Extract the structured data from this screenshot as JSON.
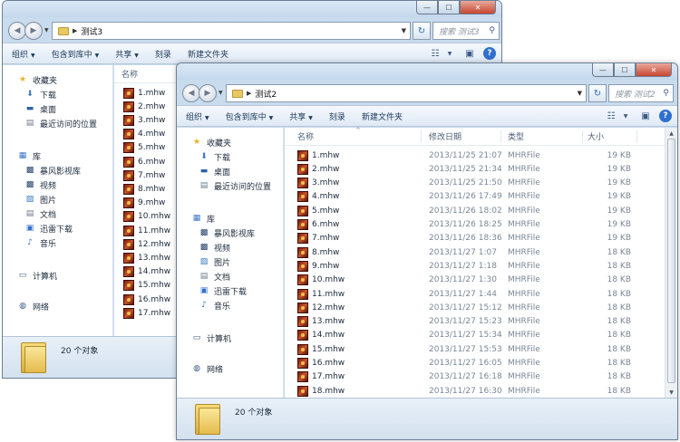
{
  "back_window": {
    "address": "测试3",
    "search_placeholder": "搜索 测试3",
    "commands": [
      "组织",
      "包含到库中",
      "共享",
      "刻录",
      "新建文件夹"
    ],
    "nav": {
      "favorites": {
        "label": "收藏夹",
        "items": [
          "下载",
          "桌面",
          "最近访问的位置"
        ]
      },
      "libraries": {
        "label": "库",
        "items": [
          "暴风影视库",
          "视频",
          "图片",
          "文档",
          "迅雷下载",
          "音乐"
        ]
      },
      "computer": "计算机",
      "network": "网络"
    },
    "column_name": "名称",
    "files": [
      "1.mhw",
      "2.mhw",
      "3.mhw",
      "4.mhw",
      "5.mhw",
      "6.mhw",
      "7.mhw",
      "8.mhw",
      "9.mhw",
      "10.mhw",
      "11.mhw",
      "12.mhw",
      "13.mhw",
      "14.mhw",
      "15.mhw",
      "16.mhw",
      "17.mhw"
    ],
    "item_count": "20 个对象"
  },
  "front_window": {
    "address": "测试2",
    "search_placeholder": "搜索 测试2",
    "commands": [
      "组织",
      "包含到库中",
      "共享",
      "刻录",
      "新建文件夹"
    ],
    "nav": {
      "favorites": {
        "label": "收藏夹",
        "items": [
          "下载",
          "桌面",
          "最近访问的位置"
        ]
      },
      "libraries": {
        "label": "库",
        "items": [
          "暴风影视库",
          "视频",
          "图片",
          "文档",
          "迅雷下载",
          "音乐"
        ]
      },
      "computer": "计算机",
      "network": "网络"
    },
    "columns": {
      "name": "名称",
      "date": "修改日期",
      "type": "类型",
      "size": "大小"
    },
    "files": [
      {
        "name": "1.mhw",
        "date": "2013/11/25 21:07",
        "type": "MHRFile",
        "size": "19 KB"
      },
      {
        "name": "2.mhw",
        "date": "2013/11/25 21:34",
        "type": "MHRFile",
        "size": "19 KB"
      },
      {
        "name": "3.mhw",
        "date": "2013/11/25 21:50",
        "type": "MHRFile",
        "size": "19 KB"
      },
      {
        "name": "4.mhw",
        "date": "2013/11/26 17:49",
        "type": "MHRFile",
        "size": "19 KB"
      },
      {
        "name": "5.mhw",
        "date": "2013/11/26 18:02",
        "type": "MHRFile",
        "size": "19 KB"
      },
      {
        "name": "6.mhw",
        "date": "2013/11/26 18:25",
        "type": "MHRFile",
        "size": "19 KB"
      },
      {
        "name": "7.mhw",
        "date": "2013/11/26 18:36",
        "type": "MHRFile",
        "size": "19 KB"
      },
      {
        "name": "8.mhw",
        "date": "2013/11/27 1:07",
        "type": "MHRFile",
        "size": "18 KB"
      },
      {
        "name": "9.mhw",
        "date": "2013/11/27 1:18",
        "type": "MHRFile",
        "size": "18 KB"
      },
      {
        "name": "10.mhw",
        "date": "2013/11/27 1:30",
        "type": "MHRFile",
        "size": "18 KB"
      },
      {
        "name": "11.mhw",
        "date": "2013/11/27 1:44",
        "type": "MHRFile",
        "size": "18 KB"
      },
      {
        "name": "12.mhw",
        "date": "2013/11/27 15:12",
        "type": "MHRFile",
        "size": "18 KB"
      },
      {
        "name": "13.mhw",
        "date": "2013/11/27 15:23",
        "type": "MHRFile",
        "size": "18 KB"
      },
      {
        "name": "14.mhw",
        "date": "2013/11/27 15:34",
        "type": "MHRFile",
        "size": "18 KB"
      },
      {
        "name": "15.mhw",
        "date": "2013/11/27 15:53",
        "type": "MHRFile",
        "size": "18 KB"
      },
      {
        "name": "16.mhw",
        "date": "2013/11/27 16:05",
        "type": "MHRFile",
        "size": "18 KB"
      },
      {
        "name": "17.mhw",
        "date": "2013/11/27 16:18",
        "type": "MHRFile",
        "size": "18 KB"
      },
      {
        "name": "18.mhw",
        "date": "2013/11/27 16:30",
        "type": "MHRFile",
        "size": "18 KB"
      }
    ],
    "item_count": "20 个对象"
  }
}
